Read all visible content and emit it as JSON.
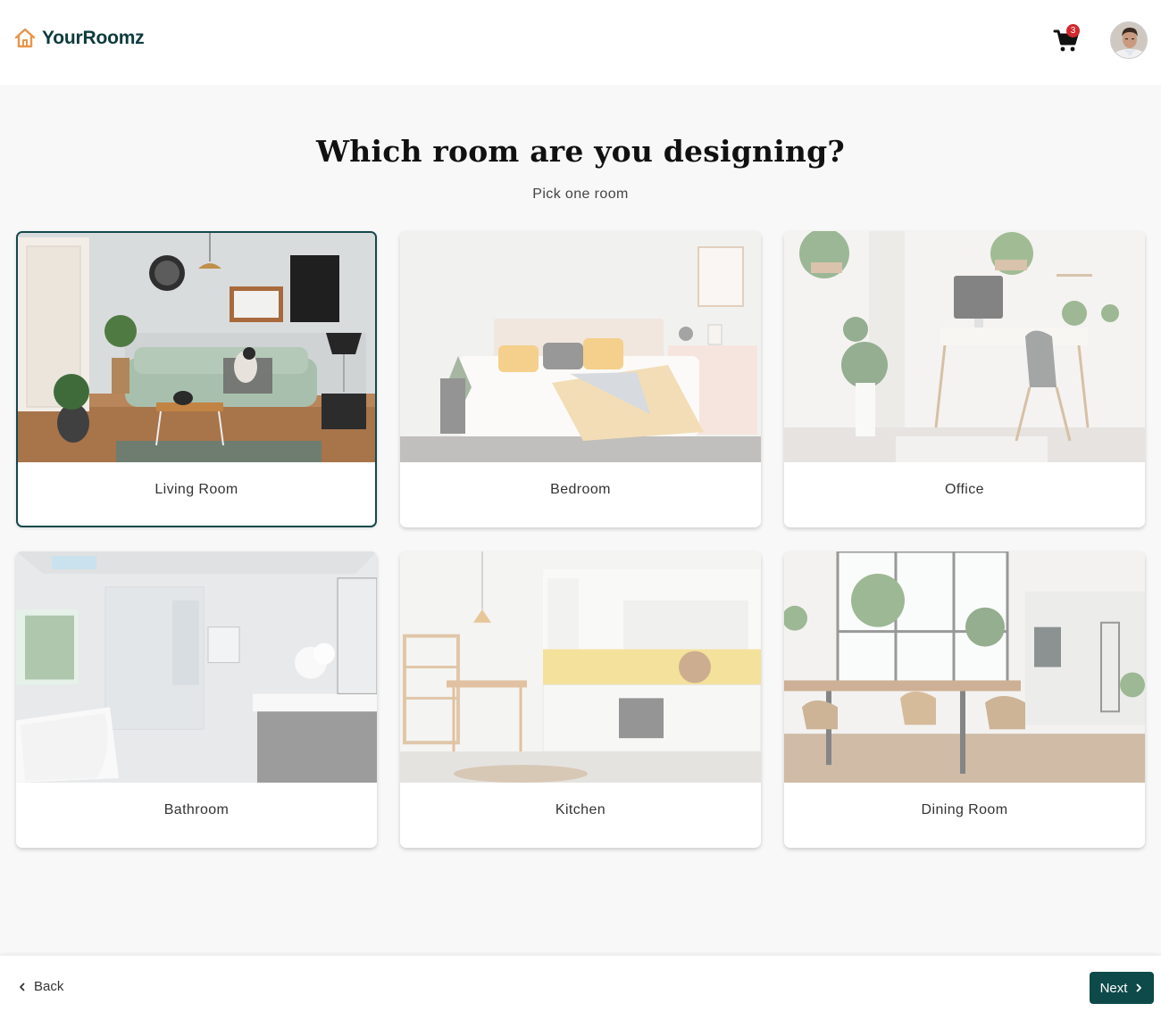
{
  "app": {
    "brand_name": "YourRoomz",
    "cart_count": "3",
    "brand_color": "#0d3b3e",
    "accent_color": "#e8954a"
  },
  "main": {
    "title": "Which room are you designing?",
    "subtitle": "Pick one room",
    "rooms": [
      {
        "label": "Living Room",
        "selected": true
      },
      {
        "label": "Bedroom",
        "selected": false
      },
      {
        "label": "Office",
        "selected": false
      },
      {
        "label": "Bathroom",
        "selected": false
      },
      {
        "label": "Kitchen",
        "selected": false
      },
      {
        "label": "Dining Room",
        "selected": false
      }
    ]
  },
  "footer": {
    "back_label": "Back",
    "next_label": "Next",
    "next_color": "#0e4a49"
  }
}
